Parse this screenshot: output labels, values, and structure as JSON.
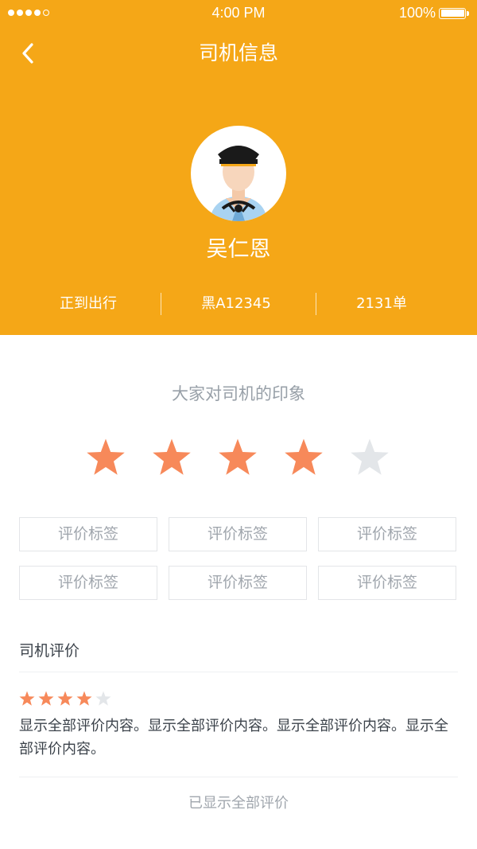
{
  "status_bar": {
    "time": "4:00 PM",
    "battery": "100%",
    "signal_filled": 4,
    "signal_total": 5,
    "battery_level": 1.0
  },
  "nav": {
    "back_icon": "chevron-left-icon",
    "title": "司机信息"
  },
  "driver": {
    "name": "吴仁恩",
    "avatar_icon": "driver-avatar-icon",
    "company": "正到出行",
    "plate": "黑A12345",
    "orders": "2131单"
  },
  "impression": {
    "title": "大家对司机的印象",
    "rating": 4,
    "max": 5,
    "tags": [
      "评价标签",
      "评价标签",
      "评价标签",
      "评价标签",
      "评价标签",
      "评价标签"
    ]
  },
  "reviews": {
    "title": "司机评价",
    "items": [
      {
        "rating": 4,
        "max": 5,
        "text": "显示全部评价内容。显示全部评价内容。显示全部评价内容。显示全部评价内容。"
      }
    ],
    "footer": "已显示全部评价"
  },
  "colors": {
    "brand": "#F5A717",
    "star_on": "#F7895A",
    "star_off": "#E3E6E9",
    "muted_text": "#98A0A8",
    "body_text": "#3B424A"
  }
}
